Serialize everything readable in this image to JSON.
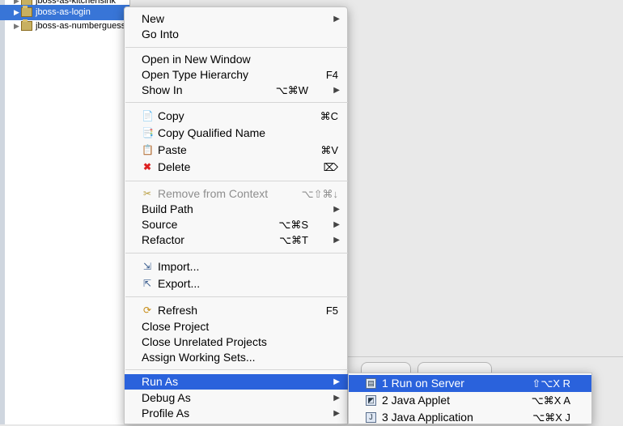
{
  "explorer": {
    "rows": [
      {
        "label": "jboss-as-kitchensink",
        "selected": false
      },
      {
        "label": "jboss-as-login",
        "selected": true
      },
      {
        "label": "jboss-as-numberguess",
        "selected": false
      }
    ]
  },
  "context_menu": {
    "items": [
      {
        "label": "New",
        "submenu": true
      },
      {
        "label": "Go Into"
      },
      {
        "label": "Open in New Window"
      },
      {
        "label": "Open Type Hierarchy",
        "shortcut": "F4"
      },
      {
        "label": "Show In",
        "shortcut": "⌥⌘W",
        "submenu": true
      },
      {
        "label": "Copy",
        "shortcut": "⌘C",
        "icon": "copy-icon"
      },
      {
        "label": "Copy Qualified Name",
        "icon": "copy-qualified-name-icon"
      },
      {
        "label": "Paste",
        "shortcut": "⌘V",
        "icon": "paste-icon"
      },
      {
        "label": "Delete",
        "shortcut": "⌦",
        "icon": "delete-icon"
      },
      {
        "label": "Remove from Context",
        "shortcut": "⌥⇧⌘↓",
        "icon": "remove-context-icon",
        "disabled": true
      },
      {
        "label": "Build Path",
        "submenu": true
      },
      {
        "label": "Source",
        "shortcut": "⌥⌘S",
        "submenu": true
      },
      {
        "label": "Refactor",
        "shortcut": "⌥⌘T",
        "submenu": true
      },
      {
        "label": "Import...",
        "icon": "import-icon"
      },
      {
        "label": "Export...",
        "icon": "export-icon"
      },
      {
        "label": "Refresh",
        "shortcut": "F5",
        "icon": "refresh-icon"
      },
      {
        "label": "Close Project"
      },
      {
        "label": "Close Unrelated Projects"
      },
      {
        "label": "Assign Working Sets..."
      },
      {
        "label": "Run As",
        "submenu": true,
        "highlighted": true
      },
      {
        "label": "Debug As",
        "submenu": true
      },
      {
        "label": "Profile As",
        "submenu": true
      }
    ]
  },
  "run_as_submenu": {
    "items": [
      {
        "label": "1 Run on Server",
        "shortcut": "⇧⌥X R",
        "icon": "server-icon",
        "highlighted": true
      },
      {
        "label": "2 Java Applet",
        "shortcut": "⌥⌘X A",
        "icon": "java-applet-icon"
      },
      {
        "label": "3 Java Application",
        "shortcut": "⌥⌘X J",
        "icon": "java-application-icon"
      }
    ]
  },
  "colors": {
    "selection": "#2a62dc",
    "tree_selection": "#3875d7",
    "delete_icon": "#d22"
  }
}
